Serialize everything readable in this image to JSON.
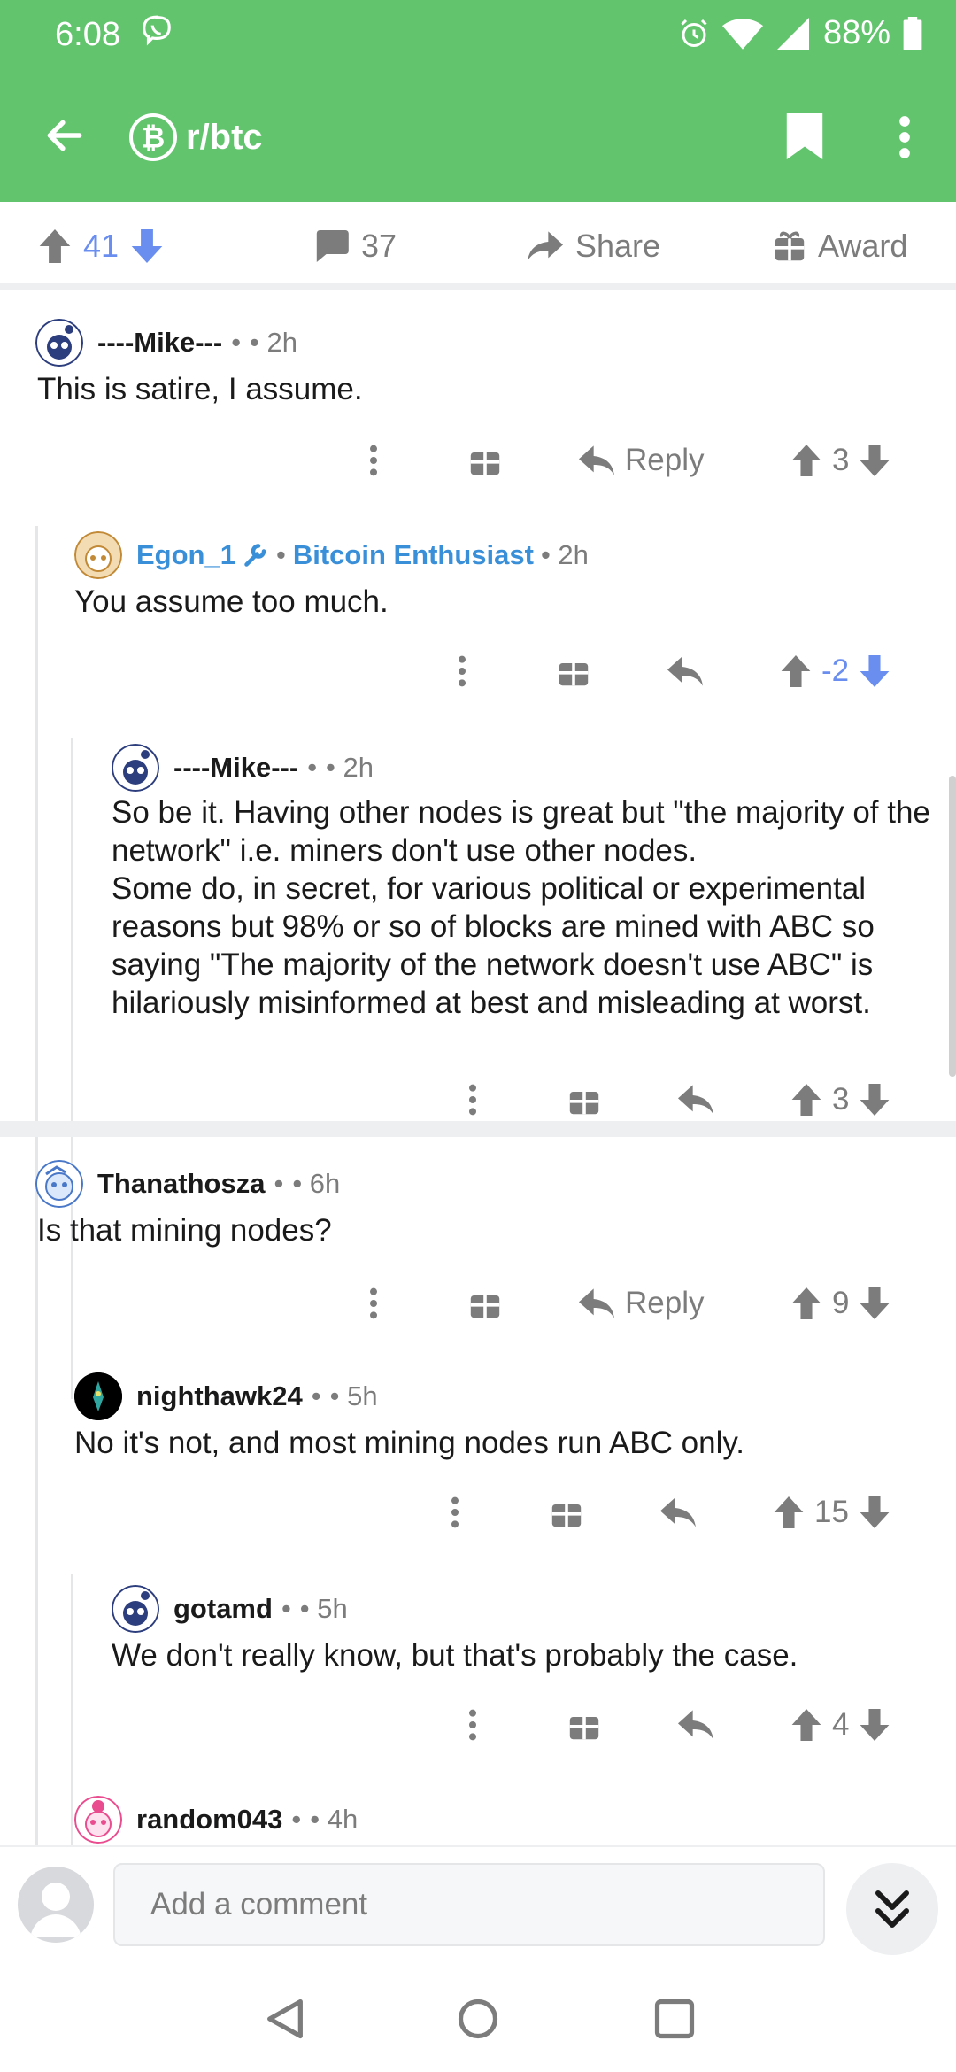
{
  "status_bar": {
    "time": "6:08",
    "battery": "88%"
  },
  "header": {
    "subreddit": "r/btc"
  },
  "post_bar": {
    "score": "41",
    "comments": "37",
    "share_label": "Share",
    "award_label": "Award"
  },
  "comments": [
    {
      "author": "----Mike---",
      "time": "• 2h",
      "body": "This is satire, I assume.",
      "reply_label": "Reply",
      "score": "3"
    },
    {
      "author": "Egon_1",
      "flair": "Bitcoin Enthusiast",
      "time": "• 2h",
      "body": "You assume too much.",
      "score": "-2"
    },
    {
      "author": "----Mike---",
      "time": "• 2h",
      "body": "So be it.  Having other nodes is great but \"the majority of the network\" i.e. miners don't use other nodes.\nSome do, in secret, for various political or experimental reasons but 98% or so of blocks are mined with ABC so saying \"The majority of the network doesn't use ABC\" is hilariously misinformed at best and misleading at worst.",
      "score": "3"
    },
    {
      "author": "Thanathosza",
      "time": "• 6h",
      "body": "Is that mining nodes?",
      "reply_label": "Reply",
      "score": "9"
    },
    {
      "author": "nighthawk24",
      "time": "• 5h",
      "body": "No it's not, and most mining nodes run ABC only.",
      "score": "15"
    },
    {
      "author": "gotamd",
      "time": "• 5h",
      "body": "We don't really know, but that's probably the case.",
      "score": "4"
    },
    {
      "author": "random043",
      "time": "• 4h"
    }
  ],
  "composer": {
    "placeholder": "Add a comment"
  },
  "colors": {
    "brand": "#62c46d",
    "downvote": "#6a8ef0",
    "flair": "#3a8fd9"
  }
}
